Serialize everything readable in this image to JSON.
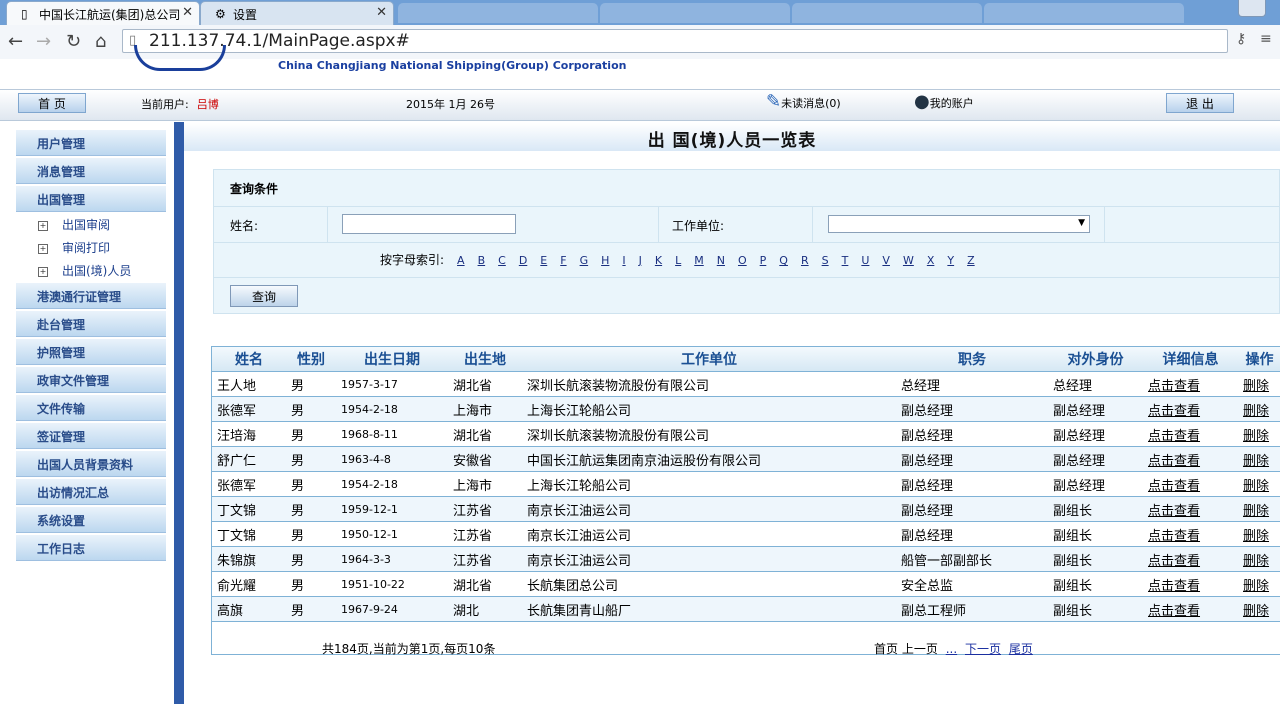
{
  "browser": {
    "tabs": [
      {
        "title": "中国长江航运(集团)总公司",
        "active": true
      },
      {
        "title": "设置",
        "active": false
      }
    ],
    "url": "211.137.74.1/MainPage.aspx#"
  },
  "header": {
    "company_en": "China Changjiang National Shipping(Group) Corporation",
    "home_label": "首 页",
    "current_user_label": "当前用户:",
    "current_user": "吕博",
    "date": "2015年  1月 26号",
    "unread_label": "未读消息(0)",
    "account_label": "我的账户",
    "logout_label": "退 出"
  },
  "sidebar": {
    "items": [
      {
        "label": "用户管理"
      },
      {
        "label": "消息管理"
      },
      {
        "label": "出国管理",
        "children": [
          "出国审阅",
          "审阅打印",
          "出国(境)人员"
        ]
      },
      {
        "label": "港澳通行证管理"
      },
      {
        "label": "赴台管理"
      },
      {
        "label": "护照管理"
      },
      {
        "label": "政审文件管理"
      },
      {
        "label": "文件传输"
      },
      {
        "label": "签证管理"
      },
      {
        "label": "出国人员背景资料"
      },
      {
        "label": "出访情况汇总"
      },
      {
        "label": "系统设置"
      },
      {
        "label": "工作日志"
      }
    ]
  },
  "main": {
    "title": "出 国(境)人员一览表",
    "query": {
      "title": "查询条件",
      "name_label": "姓名:",
      "unit_label": "工作单位:",
      "index_label": "按字母索引:",
      "letters": [
        "A",
        "B",
        "C",
        "D",
        "E",
        "F",
        "G",
        "H",
        "I",
        "J",
        "K",
        "L",
        "M",
        "N",
        "O",
        "P",
        "Q",
        "R",
        "S",
        "T",
        "U",
        "V",
        "W",
        "X",
        "Y",
        "Z"
      ],
      "button": "查询"
    },
    "table": {
      "columns": [
        "姓名",
        "性别",
        "出生日期",
        "出生地",
        "工作单位",
        "职务",
        "对外身份",
        "详细信息",
        "操作"
      ],
      "rows": [
        [
          "王人地",
          "男",
          "1957-3-17",
          "湖北省",
          "深圳长航滚装物流股份有限公司",
          "总经理",
          "总经理",
          "点击查看",
          "删除"
        ],
        [
          "张德军",
          "男",
          "1954-2-18",
          "上海市",
          "上海长江轮船公司",
          "副总经理",
          "副总经理",
          "点击查看",
          "删除"
        ],
        [
          "汪培海",
          "男",
          "1968-8-11",
          "湖北省",
          "深圳长航滚装物流股份有限公司",
          "副总经理",
          "副总经理",
          "点击查看",
          "删除"
        ],
        [
          "舒广仁",
          "男",
          "1963-4-8",
          "安徽省",
          "中国长江航运集团南京油运股份有限公司",
          "副总经理",
          "副总经理",
          "点击查看",
          "删除"
        ],
        [
          "张德军",
          "男",
          "1954-2-18",
          "上海市",
          "上海长江轮船公司",
          "副总经理",
          "副总经理",
          "点击查看",
          "删除"
        ],
        [
          "丁文锦",
          "男",
          "1959-12-1",
          "江苏省",
          "南京长江油运公司",
          "副总经理",
          "副组长",
          "点击查看",
          "删除"
        ],
        [
          "丁文锦",
          "男",
          "1950-12-1",
          "江苏省",
          "南京长江油运公司",
          "副总经理",
          "副组长",
          "点击查看",
          "删除"
        ],
        [
          "朱锦旗",
          "男",
          "1964-3-3",
          "江苏省",
          "南京长江油运公司",
          "船管一部副部长",
          "副组长",
          "点击查看",
          "删除"
        ],
        [
          "俞光耀",
          "男",
          "1951-10-22",
          "湖北省",
          "长航集团总公司",
          "安全总监",
          "副组长",
          "点击查看",
          "删除"
        ],
        [
          "高旗",
          "男",
          "1967-9-24",
          "湖北",
          "长航集团青山船厂",
          "副总工程师",
          "副组长",
          "点击查看",
          "删除"
        ]
      ]
    },
    "pager": {
      "summary": "共184页,当前为第1页,每页10条",
      "first": "首页",
      "prev": "上一页",
      "more": "...",
      "next": "下一页",
      "last": "尾页"
    }
  }
}
